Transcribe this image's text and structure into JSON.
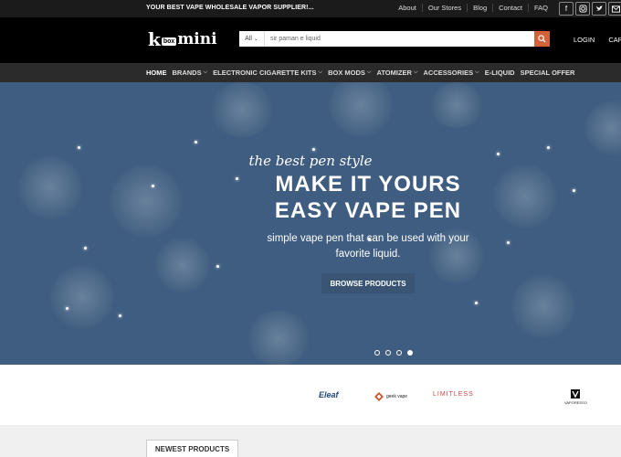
{
  "topbar": {
    "tagline": "YOUR BEST VAPE WHOLESALE VAPOR SUPPLIER!...",
    "links": [
      "About",
      "Our Stores",
      "Blog",
      "Contact",
      "FAQ"
    ],
    "social_icons": [
      "facebook-icon",
      "instagram-icon",
      "twitter-icon",
      "email-icon"
    ]
  },
  "header": {
    "logo_part1": "k",
    "logo_box": "box",
    "logo_part2": "mini",
    "search_category": "All",
    "search_value": "sir paman e liquid",
    "login": "LOGIN",
    "cart": "CART"
  },
  "nav": {
    "items": [
      {
        "label": "HOME",
        "dropdown": false
      },
      {
        "label": "BRANDS",
        "dropdown": true
      },
      {
        "label": "ELECTRONIC CIGARETTE KITS",
        "dropdown": true
      },
      {
        "label": "BOX MODS",
        "dropdown": true
      },
      {
        "label": "ATOMIZER",
        "dropdown": true
      },
      {
        "label": "ACCESSORIES",
        "dropdown": true
      },
      {
        "label": "E-LIQUID",
        "dropdown": false
      },
      {
        "label": "SPECIAL OFFER",
        "dropdown": false
      }
    ]
  },
  "hero": {
    "script_text": "the best pen style",
    "heading_line1": "MAKE IT YOURS",
    "heading_line2": "EASY VAPE PEN",
    "subtext_line1": "simple vape pen that can be used with your",
    "subtext_line2": "favorite liquid.",
    "button_label": "BROWSE PRODUCTS",
    "slides_total": 4,
    "active_slide": 4,
    "bg_color": "#3f5d80"
  },
  "brands": {
    "eleaf": "Eleaf",
    "geekvape": "geek vape",
    "limitless": "LIMITLESS",
    "vaporesso": "VAPORESSO"
  },
  "section": {
    "newest_tab": "NEWEST PRODUCTS"
  },
  "colors": {
    "accent": "#d2623a",
    "topbar": "#1b1b1b",
    "nav": "#2b2b2b"
  }
}
